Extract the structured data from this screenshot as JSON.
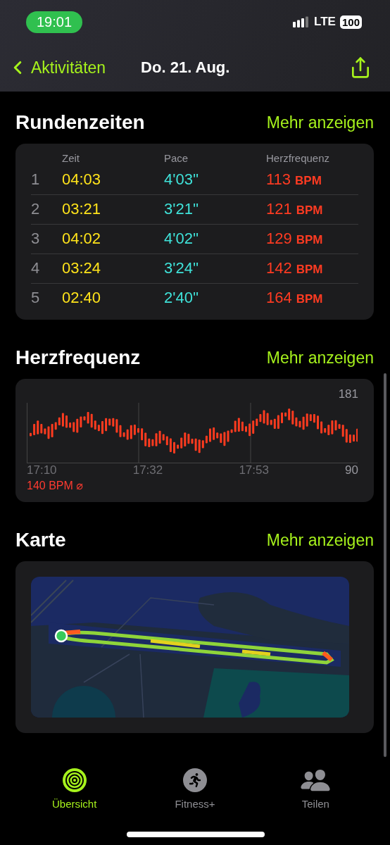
{
  "status_bar": {
    "time": "19:01",
    "network": "LTE",
    "battery": "100"
  },
  "nav": {
    "back": "Aktivitäten",
    "title": "Do. 21. Aug."
  },
  "laps": {
    "title": "Rundenzeiten",
    "more": "Mehr anzeigen",
    "columns": [
      "Zeit",
      "Pace",
      "Herzfrequenz"
    ],
    "rows": [
      {
        "index": "1",
        "time": "04:03",
        "pace": "4'03''",
        "hr": "113",
        "unit": "BPM"
      },
      {
        "index": "2",
        "time": "03:21",
        "pace": "3'21''",
        "hr": "121",
        "unit": "BPM"
      },
      {
        "index": "3",
        "time": "04:02",
        "pace": "4'02''",
        "hr": "129",
        "unit": "BPM"
      },
      {
        "index": "4",
        "time": "03:24",
        "pace": "3'24''",
        "hr": "142",
        "unit": "BPM"
      },
      {
        "index": "5",
        "time": "02:40",
        "pace": "2'40''",
        "hr": "164",
        "unit": "BPM"
      }
    ]
  },
  "heart_rate": {
    "title": "Herzfrequenz",
    "more": "Mehr anzeigen",
    "max": "181",
    "min": "90",
    "times": [
      "17:10",
      "17:32",
      "17:53"
    ],
    "average": "140 BPM ⌀"
  },
  "map": {
    "title": "Karte",
    "more": "Mehr anzeigen",
    "kind": "picture"
  },
  "tabs": [
    {
      "label": "Übersicht",
      "selected": true,
      "kind": "rings"
    },
    {
      "label": "Fitness+",
      "selected": false,
      "kind": "runner"
    },
    {
      "label": "Teilen",
      "selected": false,
      "kind": "people"
    }
  ]
}
